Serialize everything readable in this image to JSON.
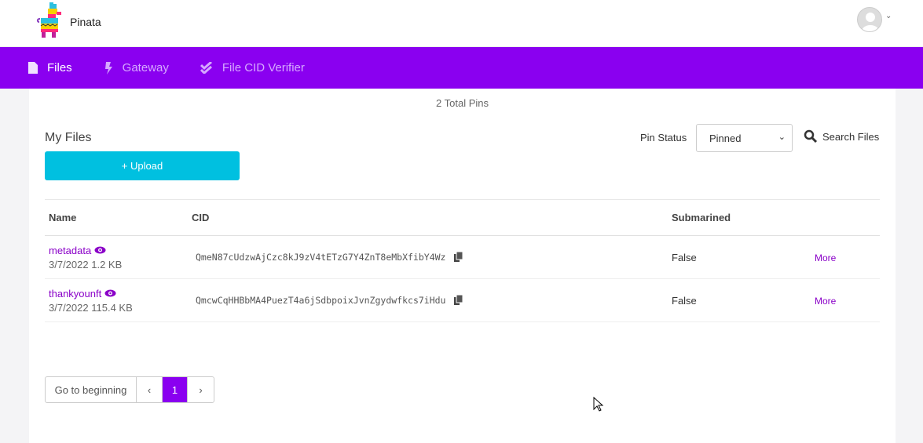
{
  "app": {
    "name": "Pinata"
  },
  "nav": [
    {
      "label": "Files",
      "icon": "file-icon",
      "active": true
    },
    {
      "label": "Gateway",
      "icon": "bolt-icon"
    },
    {
      "label": "File CID Verifier",
      "icon": "double-check-icon"
    }
  ],
  "main": {
    "total_pins": "2 Total Pins",
    "title": "My Files",
    "upload_label": "+  Upload",
    "pin_status_label": "Pin Status",
    "pin_status_value": "Pinned",
    "search_label": "Search Files",
    "columns": [
      "Name",
      "CID",
      "Submarined",
      ""
    ],
    "rows": [
      {
        "name": "metadata",
        "date": "3/7/2022",
        "size": "1.2 KB",
        "cid": "QmeN87cUdzwAjCzc8kJ9zV4tETzG7Y4ZnT8eMbXfibY4Wz",
        "submarined": "False",
        "more": "More"
      },
      {
        "name": "thankyounft",
        "date": "3/7/2022",
        "size": "115.4 KB",
        "cid": "QmcwCqHHBbMA4PuezT4a6jSdbpoixJvnZgydwfkcs7iHdu",
        "submarined": "False",
        "more": "More"
      }
    ],
    "pager": {
      "first": "Go to beginning",
      "current": "1"
    }
  },
  "colors": {
    "accent": "#8a00f0",
    "upload": "#00c0e0"
  }
}
